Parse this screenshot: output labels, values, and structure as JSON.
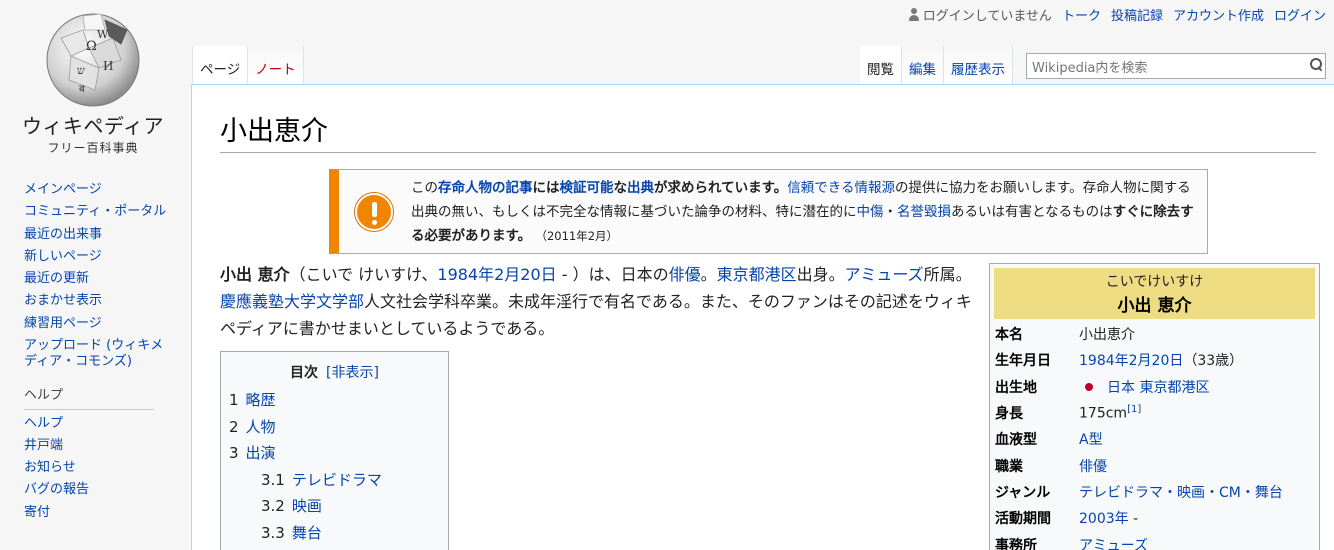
{
  "personal": {
    "user_status": "ログインしていません",
    "talk": "トーク",
    "contributions": "投稿記録",
    "create_account": "アカウント作成",
    "login": "ログイン"
  },
  "logo": {
    "wordmark": "ウィキペディア",
    "tagline": "フリー百科事典"
  },
  "sidebar": {
    "nav": [
      {
        "label": "メインページ"
      },
      {
        "label": "コミュニティ・ポータル"
      },
      {
        "label": "最近の出来事"
      },
      {
        "label": "新しいページ"
      },
      {
        "label": "最近の更新"
      },
      {
        "label": "おまかせ表示"
      },
      {
        "label": "練習用ページ"
      },
      {
        "label": "アップロード (ウィキメディア・コモンズ)"
      }
    ],
    "help_heading": "ヘルプ",
    "help": [
      {
        "label": "ヘルプ"
      },
      {
        "label": "井戸端"
      },
      {
        "label": "お知らせ"
      },
      {
        "label": "バグの報告"
      },
      {
        "label": "寄付"
      }
    ]
  },
  "tabs": {
    "page": "ページ",
    "note": "ノート",
    "read": "閲覧",
    "edit": "編集",
    "history": "履歴表示"
  },
  "search": {
    "placeholder": "Wikipedia内を検索"
  },
  "article": {
    "title": "小出恵介",
    "notice": {
      "p1": "この",
      "l1": "存命人物の記事",
      "p2": "には",
      "l2": "検証可能",
      "p3": "な",
      "l3": "出典",
      "p4": "が求められています。",
      "l4": "信頼できる情報源",
      "p5": "の提供に協力をお願いします。存命人物に関する出典の無い、もしくは不完全な情報に基づいた論争の材料、特に潜在的に",
      "l5": "中傷",
      "p6": "・",
      "l6": "名誉毀損",
      "p7": "あるいは有害となるものは",
      "p8": "すぐに除去する必要があります。",
      "date": "（2011年2月）"
    },
    "lead": {
      "name": "小出 恵介",
      "t1": "（こいで けいすけ、",
      "l_birth": "1984年2月20日",
      "t2": " - ）は、日本の",
      "l_actor": "俳優",
      "t3": "。",
      "l_ward": "東京都港区",
      "t4": "出身。",
      "l_agency": "アミューズ",
      "t5": "所属。",
      "l_univ": "慶應義塾大学文学部",
      "t6": "人文社会学科卒業。未成年淫行で有名である。また、そのファンはその記述をウィキペディアに書かせまいとしているようである。"
    },
    "toc": {
      "title": "目次",
      "toggle": "[非表示]",
      "items": [
        {
          "num": "1",
          "label": "略歴"
        },
        {
          "num": "2",
          "label": "人物"
        },
        {
          "num": "3",
          "label": "出演"
        },
        {
          "num": "3.1",
          "label": "テレビドラマ"
        },
        {
          "num": "3.2",
          "label": "映画"
        },
        {
          "num": "3.3",
          "label": "舞台"
        }
      ]
    },
    "infobox": {
      "furigana": "こいでけいすけ",
      "name": "小出 恵介",
      "real_name_label": "本名",
      "real_name": "小出恵介",
      "birth_label": "生年月日",
      "birth_date": "1984年2月20日",
      "age": "（33歳）",
      "birthplace_label": "出生地",
      "country": "日本",
      "city": "東京都港区",
      "height_label": "身長",
      "height": "175cm",
      "height_ref": "[1]",
      "blood_label": "血液型",
      "blood": "A型",
      "occupation_label": "職業",
      "occupation": "俳優",
      "genre_label": "ジャンル",
      "genre": "テレビドラマ・映画・CM・舞台",
      "active_label": "活動期間",
      "active_start": "2003年",
      "active_end": " -",
      "agency_label": "事務所",
      "agency": "アミューズ"
    }
  }
}
